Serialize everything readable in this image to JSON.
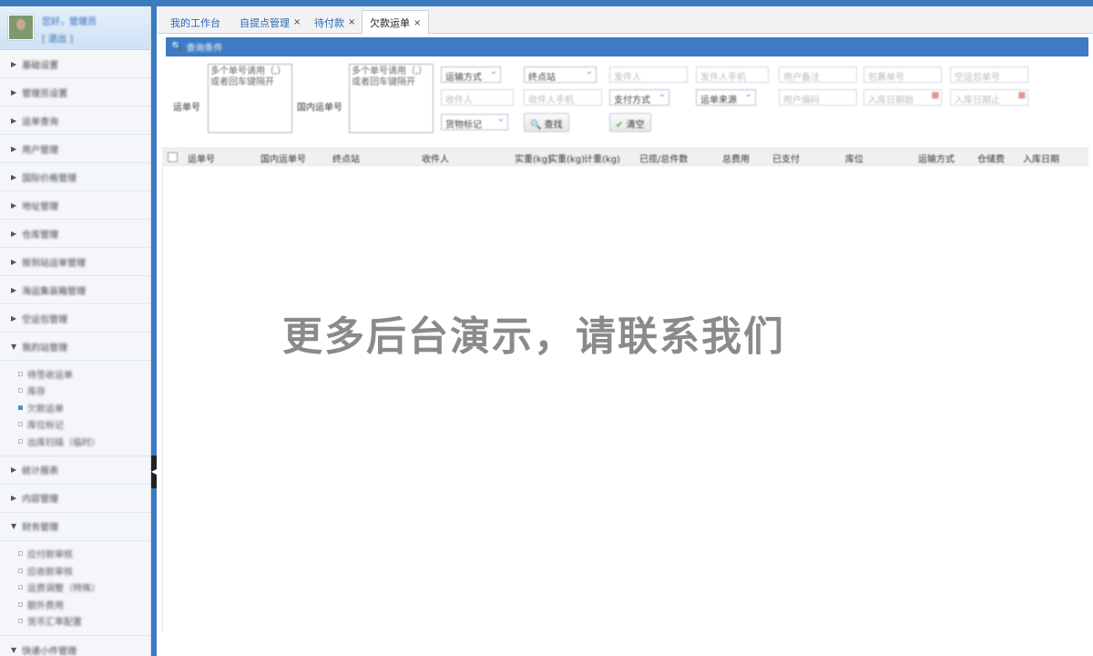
{
  "user": {
    "line1": "您好，管理员",
    "line2": "[ 退出 ]"
  },
  "sidebar": {
    "groups_top": [
      "基础设置",
      "管理员设置",
      "运单查询",
      "用户管理",
      "国际价格管理",
      "地址管理",
      "仓库管理",
      "按到站运单管理",
      "海运集装箱管理",
      "空运包管理"
    ],
    "group_expanded_1": {
      "label": "我的站管理",
      "items": [
        "待签收运单",
        "库存",
        "欠款运单",
        "库位标记",
        "出库扫描（临时）"
      ],
      "active_index": 2
    },
    "groups_mid": [
      "统计报表",
      "内容管理"
    ],
    "group_expanded_2": {
      "label": "财务管理",
      "items": [
        "应付款审核",
        "应收款审核",
        "运费调整（特殊）",
        "额外费用",
        "货币汇率配置"
      ]
    },
    "group_bottom": "快递小件管理"
  },
  "tabs": [
    {
      "label": "我的工作台",
      "closable": false
    },
    {
      "label": "自提点管理",
      "closable": true
    },
    {
      "label": "待付款",
      "closable": true
    },
    {
      "label": "欠款运单",
      "closable": true,
      "active": true
    }
  ],
  "panel": {
    "title": "查询条件",
    "tracking_label": "运单号",
    "tracking_placeholder": "多个单号请用（,）或者回车键隔开",
    "domestic_label": "国内运单号",
    "domestic_placeholder": "多个单号请用（,）或者回车键隔开",
    "row1": {
      "transport_select": "运输方式",
      "station_select": "终点站",
      "sender": "发件人",
      "sender_phone": "发件人手机",
      "user_note": "用户备注",
      "package_no": "包裹单号",
      "air_package_no": "空运包单号"
    },
    "row2": {
      "receiver": "收件人",
      "receiver_phone": "收件人手机",
      "pay_select": "支付方式",
      "source_select": "运单来源",
      "user_code": "用户编码",
      "start_date": "入库日期始",
      "end_date": "入库日期止"
    },
    "row3": {
      "goods_select": "货物标记",
      "search_button": "查找",
      "clear_button": "清空"
    }
  },
  "grid": {
    "columns": [
      "运单号",
      "国内运单号",
      "终点站",
      "收件人",
      "实重(kg)",
      "实重(kg)",
      "计重(kg)",
      "已揽/总件数",
      "总费用",
      "已支付",
      "库位",
      "运输方式",
      "仓储费",
      "入库日期"
    ]
  },
  "watermark": "更多后台演示，请联系我们",
  "colors": {
    "primary": "#3a7bbf",
    "panel_head": "#3d7cc4",
    "link": "#2d67b4"
  }
}
